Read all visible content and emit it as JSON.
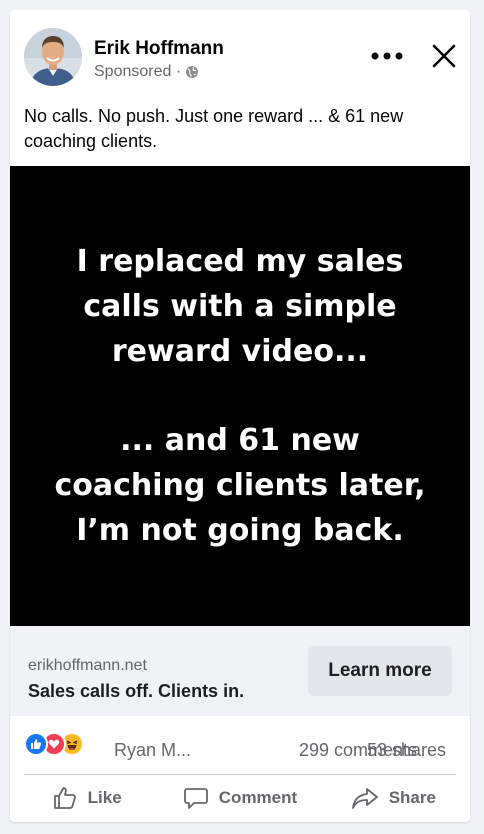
{
  "post": {
    "author": "Erik Hoffmann",
    "sponsored_label": "Sponsored ·",
    "caption": "No calls. No push. Just one reward ... & 61 new coaching clients."
  },
  "media": {
    "headline_line_1": "I replaced my sales",
    "headline_line_2": "calls with a simple",
    "headline_line_3": "reward video...",
    "followup_line_1": "... and 61 new",
    "followup_line_2": "coaching clients later,",
    "followup_line_3": "I’m not going back.",
    "background_color": "#000000",
    "text_color": "#ffffff"
  },
  "link": {
    "domain": "erikhoffmann.net",
    "headline": "Sales calls off. Clients in.",
    "cta_label": "Learn more"
  },
  "stats": {
    "reactor_name": "Ryan M...",
    "comments": "299 comments",
    "shares": "53 shares",
    "reaction_icons": [
      "like-reaction-icon",
      "love-reaction-icon",
      "haha-reaction-icon"
    ]
  },
  "actions": {
    "like_label": "Like",
    "comment_label": "Comment",
    "share_label": "Share"
  },
  "colors": {
    "brand_blue": "#1877f2",
    "love_red": "#f33e58",
    "haha_yellow": "#f7b928",
    "secondary_text": "#65676b"
  }
}
